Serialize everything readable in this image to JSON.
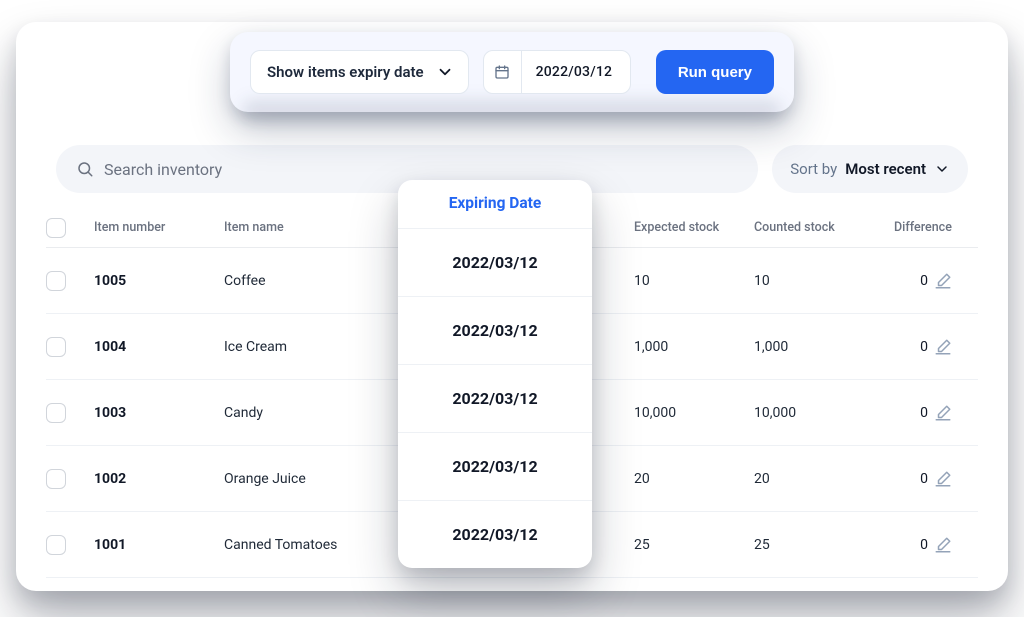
{
  "query_bar": {
    "select_label": "Show items expiry date",
    "date_value": "2022/03/12",
    "run_label": "Run query"
  },
  "toolbar": {
    "search_placeholder": "Search inventory",
    "sort_label": "Sort by",
    "sort_value": "Most recent"
  },
  "columns": {
    "item_number": "Item number",
    "item_name": "Item name",
    "expected": "Expected stock",
    "counted": "Counted stock",
    "difference": "Difference"
  },
  "expiry_popover": {
    "title": "Expiring Date",
    "dates": [
      "2022/03/12",
      "2022/03/12",
      "2022/03/12",
      "2022/03/12",
      "2022/03/12"
    ]
  },
  "rows": [
    {
      "number": "1005",
      "name": "Coffee",
      "expected": "10",
      "counted": "10",
      "diff": "0"
    },
    {
      "number": "1004",
      "name": "Ice Cream",
      "expected": "1,000",
      "counted": "1,000",
      "diff": "0"
    },
    {
      "number": "1003",
      "name": "Candy",
      "expected": "10,000",
      "counted": "10,000",
      "diff": "0"
    },
    {
      "number": "1002",
      "name": "Orange Juice",
      "expected": "20",
      "counted": "20",
      "diff": "0"
    },
    {
      "number": "1001",
      "name": "Canned Tomatoes",
      "expected": "25",
      "counted": "25",
      "diff": "0"
    }
  ]
}
